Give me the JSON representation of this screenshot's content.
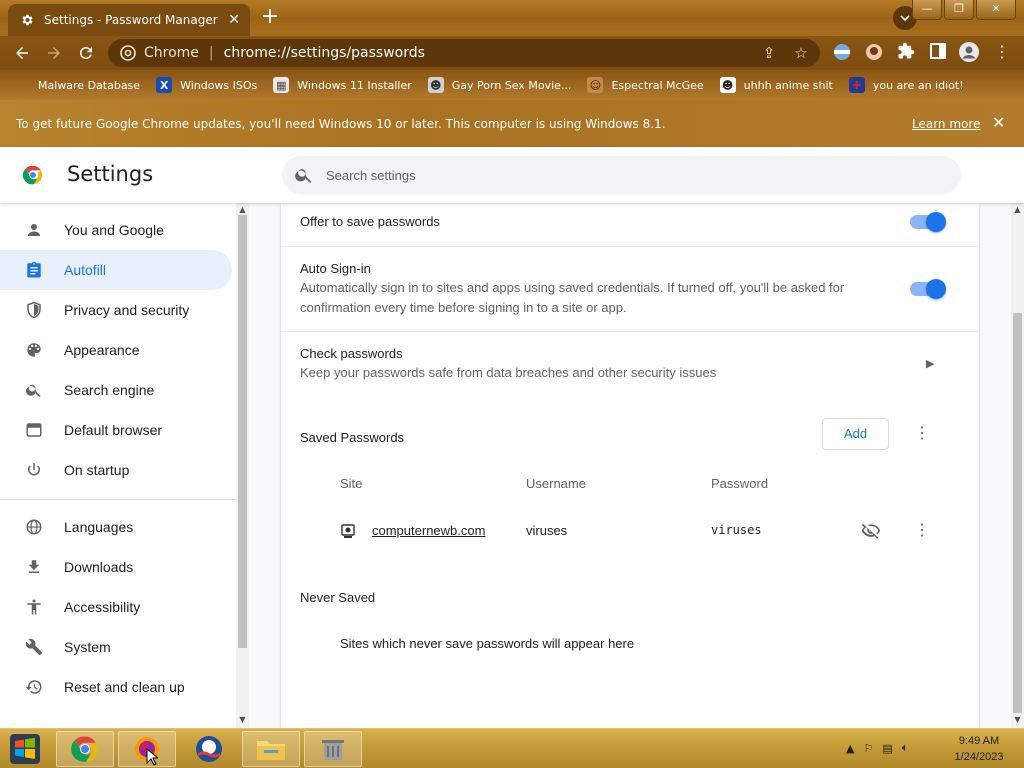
{
  "window": {
    "tab_title": "Settings - Password Manager",
    "tab_close": "✕",
    "new_tab": "+",
    "controls": [
      "—",
      "❐",
      "✕"
    ]
  },
  "toolbar": {
    "site_label": "Chrome",
    "url": "chrome://settings/passwords"
  },
  "bookmarks": [
    {
      "label": "Malware Database",
      "icon": "",
      "color": "#8a5514"
    },
    {
      "label": "Windows ISOs",
      "icon": "X",
      "color": "#1a4bb5"
    },
    {
      "label": "Windows 11 Installer",
      "icon": "▦",
      "color": "#e8e8e8"
    },
    {
      "label": "Gay Porn Sex Movie...",
      "icon": "☻",
      "color": "#d0d0d0"
    },
    {
      "label": "Espectral McGee",
      "icon": "☺",
      "color": "#c58a4a"
    },
    {
      "label": "uhhh anime shit",
      "icon": "☻",
      "color": "#ffffff"
    },
    {
      "label": "you are an idiot!",
      "icon": "✚",
      "color": "#c62828"
    }
  ],
  "infobar": {
    "message": "To get future Google Chrome updates, you'll need Windows 10 or later. This computer is using Windows 8.1.",
    "link": "Learn more",
    "close": "✕"
  },
  "header": {
    "title": "Settings",
    "search_placeholder": "Search settings"
  },
  "sidebar": {
    "items": [
      {
        "label": "You and Google",
        "icon": "person-icon"
      },
      {
        "label": "Autofill",
        "icon": "clipboard-icon",
        "active": true
      },
      {
        "label": "Privacy and security",
        "icon": "shield-icon"
      },
      {
        "label": "Appearance",
        "icon": "palette-icon"
      },
      {
        "label": "Search engine",
        "icon": "search-icon"
      },
      {
        "label": "Default browser",
        "icon": "browser-icon"
      },
      {
        "label": "On startup",
        "icon": "power-icon"
      },
      {
        "label": "Languages",
        "icon": "globe-icon"
      },
      {
        "label": "Downloads",
        "icon": "download-icon"
      },
      {
        "label": "Accessibility",
        "icon": "accessibility-icon"
      },
      {
        "label": "System",
        "icon": "wrench-icon"
      },
      {
        "label": "Reset and clean up",
        "icon": "reset-icon"
      }
    ]
  },
  "passwords": {
    "offer_save_label": "Offer to save passwords",
    "offer_save_on": true,
    "auto_signin_label": "Auto Sign-in",
    "auto_signin_desc": "Automatically sign in to sites and apps using saved credentials. If turned off, you'll be asked for confirmation every time before signing in to a site or app.",
    "auto_signin_on": true,
    "check_label": "Check passwords",
    "check_desc": "Keep your passwords safe from data breaches and other security issues",
    "saved_heading": "Saved Passwords",
    "add_label": "Add",
    "columns": {
      "site": "Site",
      "username": "Username",
      "password": "Password"
    },
    "entries": [
      {
        "site": "computernewb.com",
        "username": "viruses",
        "password": "viruses"
      }
    ],
    "never_heading": "Never Saved",
    "never_message": "Sites which never save passwords will appear here"
  },
  "taskbar": {
    "apps": [
      "windows-logo-app",
      "chrome-app",
      "firefox-app",
      "obama-app",
      "file-explorer-app",
      "trash-app"
    ],
    "time": "9:49 AM",
    "date": "1/24/2023"
  },
  "colors": {
    "accent": "#1a73e8",
    "active_nav_bg": "#e8f0fe",
    "chrome_frame": "#9c6418"
  }
}
